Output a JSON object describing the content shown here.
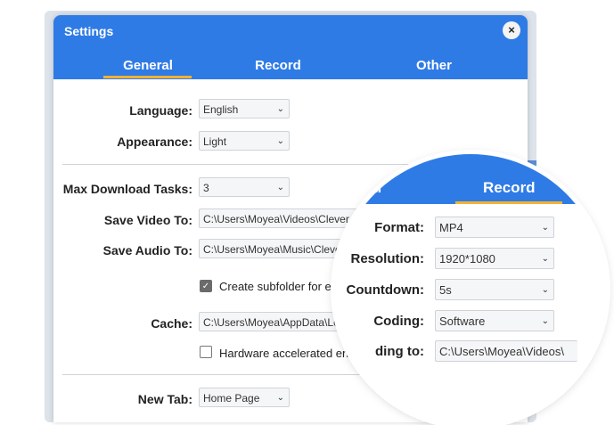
{
  "dialog": {
    "title": "Settings",
    "close_icon": "×",
    "tabs": [
      "General",
      "Record",
      "Other"
    ]
  },
  "general": {
    "language_label": "Language:",
    "language_value": "English",
    "appearance_label": "Appearance:",
    "appearance_value": "Light",
    "max_tasks_label": "Max Download Tasks:",
    "max_tasks_value": "3",
    "save_video_label": "Save Video To:",
    "save_video_value": "C:\\Users\\Moyea\\Videos\\Clever",
    "save_audio_label": "Save Audio To:",
    "save_audio_value": "C:\\Users\\Moyea\\Music\\Cleve",
    "subfolder_label": "Create subfolder for ea",
    "cache_label": "Cache:",
    "cache_value": "C:\\Users\\Moyea\\AppData\\Local",
    "hw_accel_label": "Hardware accelerated encoding",
    "new_tab_label": "New Tab:",
    "new_tab_value": "Home Page"
  },
  "magnifier": {
    "left_tab": "al",
    "tab": "Record",
    "format_label": "Format:",
    "format_value": "MP4",
    "resolution_label": "Resolution:",
    "resolution_value": "1920*1080",
    "countdown_label": "Countdown:",
    "countdown_value": "5s",
    "coding_label": "Coding:",
    "coding_value": "Software",
    "recording_to_label": "ding to:",
    "recording_to_value": "C:\\Users\\Moyea\\Videos\\"
  },
  "icons": {
    "chevron": "⌄",
    "check": "✓"
  }
}
